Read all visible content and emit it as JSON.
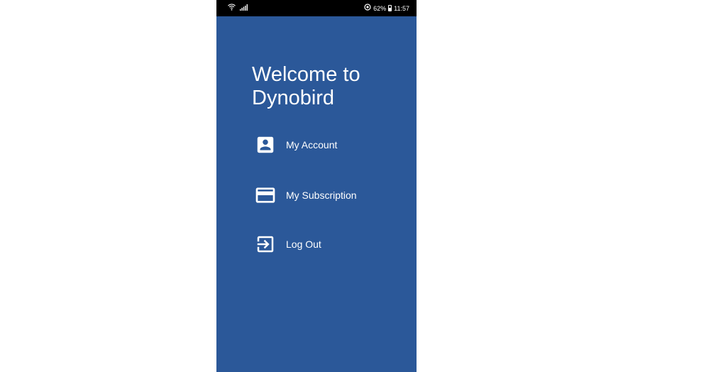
{
  "status_bar": {
    "battery_percent": "62%",
    "time": "11:57",
    "icons": [
      "wifi-icon",
      "signal-icon",
      "sync-icon",
      "battery-icon"
    ]
  },
  "drawer": {
    "title": "Welcome to Dynobird",
    "background_color": "#2b5899",
    "items": [
      {
        "label": "My Account",
        "icon": "account-box-icon"
      },
      {
        "label": "My Subscription",
        "icon": "credit-card-icon"
      },
      {
        "label": "Log Out",
        "icon": "exit-to-app-icon"
      }
    ]
  }
}
